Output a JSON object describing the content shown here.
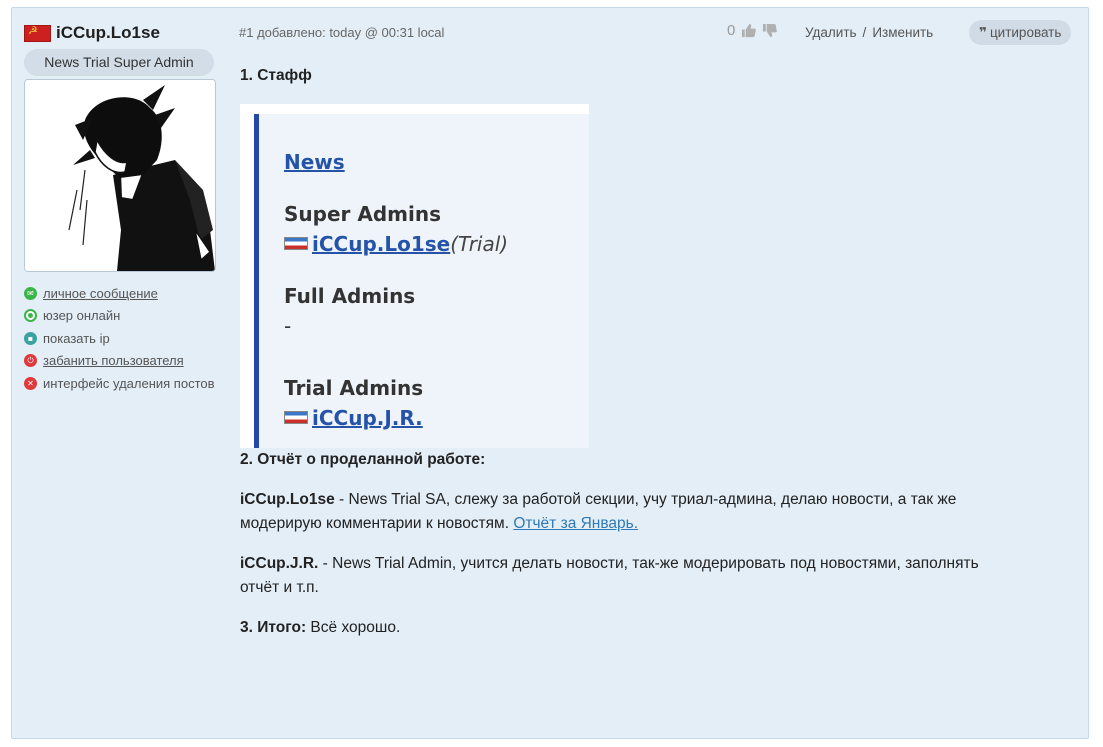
{
  "author": {
    "name": "iCCup.Lo1se",
    "role": "News Trial Super Admin",
    "actions": [
      {
        "label": "личное сообщение",
        "link": true,
        "icon": "message-icon"
      },
      {
        "label": "юзер онлайн",
        "link": false,
        "icon": "online-icon"
      },
      {
        "label": "показать ip",
        "link": false,
        "icon": "ip-icon"
      },
      {
        "label": "забанить пользователя",
        "link": true,
        "icon": "ban-icon"
      },
      {
        "label": "интерфейс удаления постов",
        "link": false,
        "icon": "delete-posts-icon"
      }
    ]
  },
  "post": {
    "meta": "#1 добавлено: today @ 00:31 local",
    "vote_count": "0",
    "delete_label": "Удалить",
    "edit_label": "Изменить",
    "quote_label": "цитировать"
  },
  "content": {
    "staff_heading": "1. Стафф",
    "staff": {
      "news_link": "News",
      "super_admins_title": "Super Admins",
      "super_admin_name": "iCCup.Lo1se",
      "super_admin_note": "(Trial)",
      "full_admins_title": "Full Admins",
      "full_admins_value": "-",
      "trial_admins_title": "Trial Admins",
      "trial_admin_name": "iCCup.J.R."
    },
    "report_heading": "2. Отчёт о проделанной работе:",
    "report1_name": "iCCup.Lo1se",
    "report1_text": " - News Trial SA, слежу за работой секции, учу триал-админа, делаю новости, а так же модерирую комментарии к новостям. ",
    "report1_link": "Отчёт за Январь.",
    "report2_name": "iCCup.J.R.",
    "report2_text": " - News Trial Admin, учится делать новости, так-же модерировать под новостями, заполнять отчёт и т.п.",
    "total_label": "3. Итого:",
    "total_text": " Всё хорошо."
  }
}
